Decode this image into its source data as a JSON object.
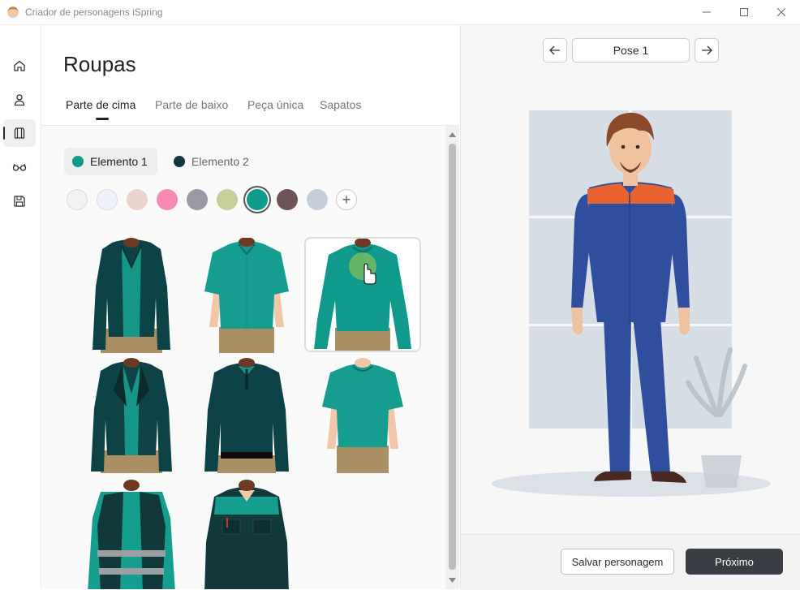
{
  "window": {
    "title": "Criador de personagens iSpring",
    "controls": [
      "minimize",
      "maximize",
      "close"
    ]
  },
  "sidebar": {
    "items": [
      {
        "icon": "home-icon",
        "active": false
      },
      {
        "icon": "person-icon",
        "active": false
      },
      {
        "icon": "shirt-icon",
        "active": true
      },
      {
        "icon": "glasses-icon",
        "active": false
      },
      {
        "icon": "save-icon",
        "active": false
      }
    ]
  },
  "panel": {
    "title": "Roupas",
    "tabs": [
      "Parte de cima",
      "Parte de baixo",
      "Peça única",
      "Sapatos"
    ],
    "active_tab": "Parte de cima",
    "elements": [
      {
        "label": "Elemento 1",
        "color": "#0f9a8c",
        "active": true
      },
      {
        "label": "Elemento 2",
        "color": "#12373f",
        "active": false
      }
    ],
    "swatches": [
      "#f2f2f2",
      "#eef1f7",
      "#ecd3cc",
      "#f78ab5",
      "#9b97a3",
      "#c8cf9b",
      "#0f9a8c",
      "#6e5358",
      "#c6cedc"
    ],
    "selected_swatch": "#0f9a8c",
    "add_color_label": "+"
  },
  "preview": {
    "pose_label": "Pose 1",
    "save_button": "Salvar personagem",
    "next_button": "Próximo"
  }
}
